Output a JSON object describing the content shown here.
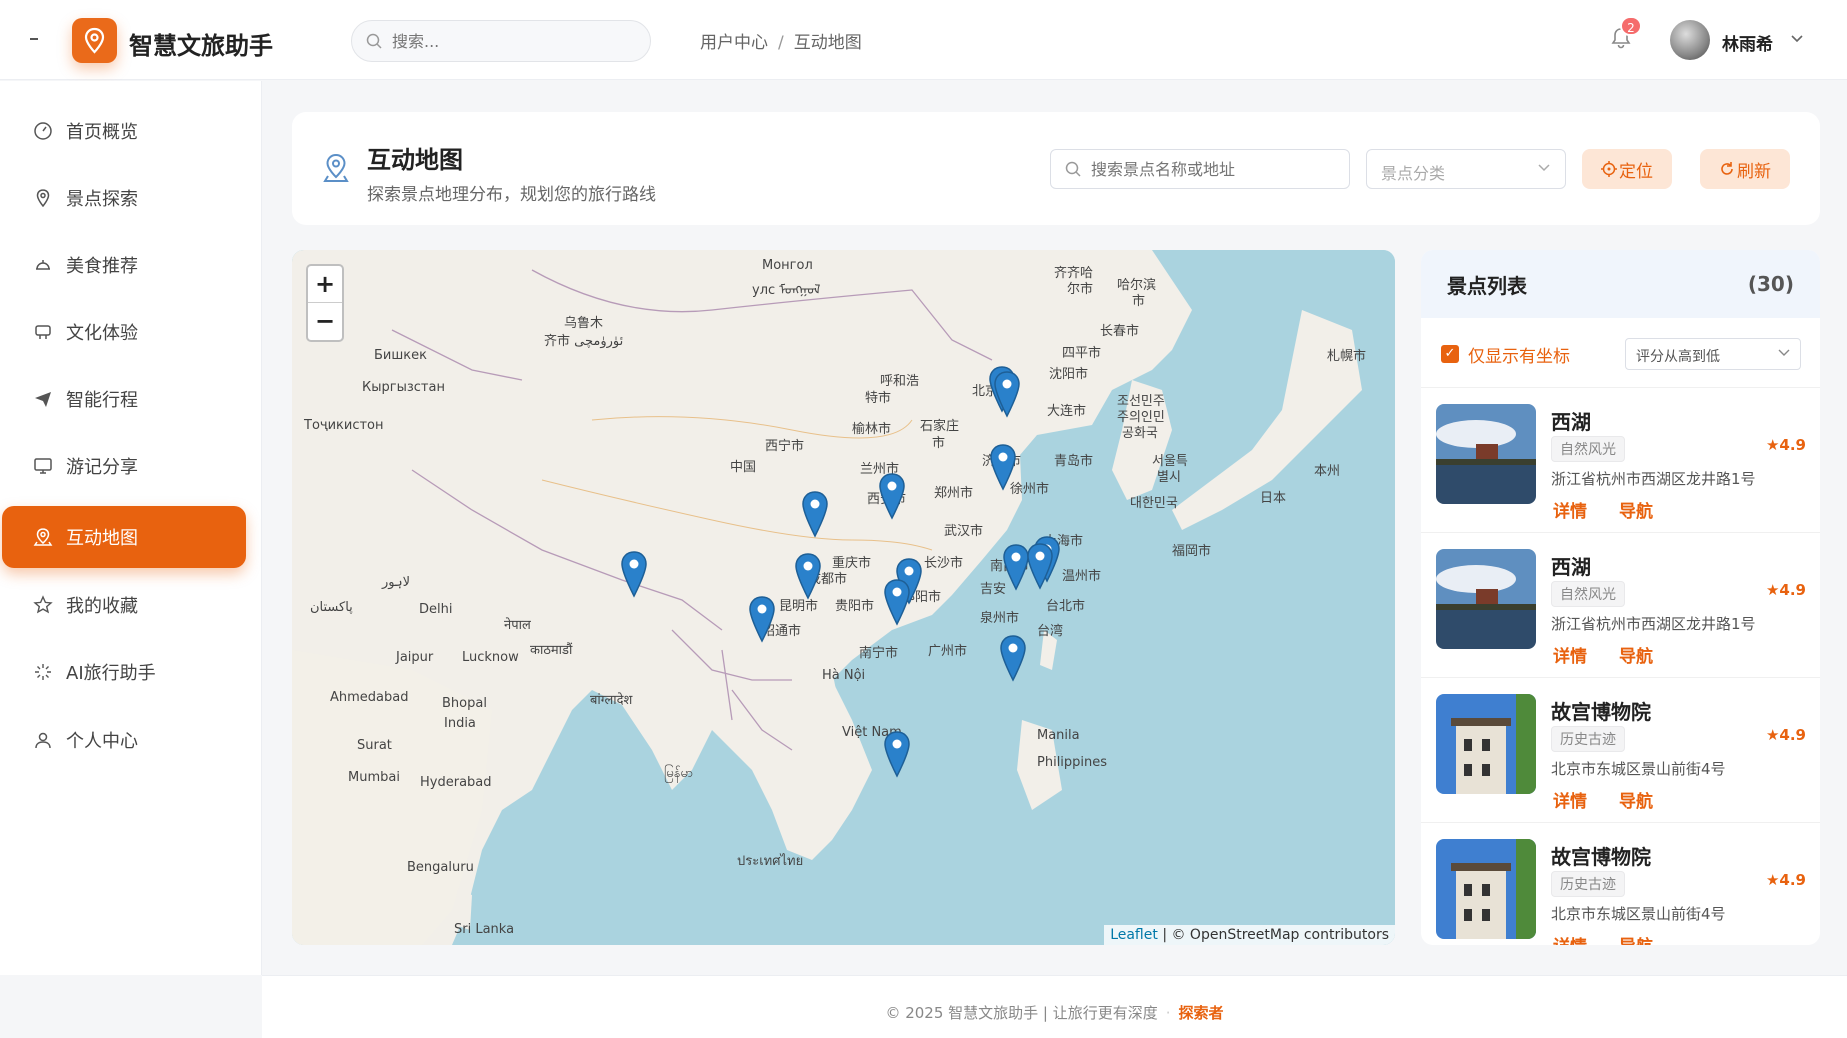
{
  "app": {
    "title": "智慧文旅助手"
  },
  "header": {
    "search_placeholder": "搜索...",
    "breadcrumb": [
      "用户中心",
      "互动地图"
    ],
    "notification_count": "2",
    "username": "林雨希"
  },
  "sidebar": {
    "items": [
      {
        "label": "首页概览",
        "icon": "dashboard-icon"
      },
      {
        "label": "景点探索",
        "icon": "location-pin-icon"
      },
      {
        "label": "美食推荐",
        "icon": "dish-icon"
      },
      {
        "label": "文化体验",
        "icon": "culture-icon"
      },
      {
        "label": "智能行程",
        "icon": "paper-plane-icon"
      },
      {
        "label": "游记分享",
        "icon": "monitor-icon"
      },
      {
        "label": "互动地图",
        "icon": "map-pin-icon",
        "active": true
      },
      {
        "label": "我的收藏",
        "icon": "star-icon"
      },
      {
        "label": "AI旅行助手",
        "icon": "sparkle-icon"
      },
      {
        "label": "个人中心",
        "icon": "user-icon"
      }
    ]
  },
  "page": {
    "title": "互动地图",
    "subtitle": "探索景点地理分布，规划您的旅行路线",
    "search_placeholder": "搜索景点名称或地址",
    "category_placeholder": "景点分类",
    "locate_label": "定位",
    "refresh_label": "刷新"
  },
  "map": {
    "zoom_in": "+",
    "zoom_out": "−",
    "attribution_leaflet": "Leaflet",
    "attribution_text": "| © OpenStreetMap contributors",
    "labels": [
      "Монгол",
      "улс ᠮᠣᠩᠭᠣᠯ",
      "乌鲁木",
      "齐市 ئۈرۈمچی",
      "Бишкек",
      "Кыргызстан",
      "Тоҷикистон",
      "齐齐哈",
      "尔市",
      "哈尔滨",
      "市",
      "长春市",
      "四平市",
      "沈阳市",
      "呼和浩",
      "特市",
      "北京市",
      "大连市",
      "榆林市",
      "石家庄",
      "市",
      "济南市",
      "青岛市",
      "西宁市",
      "中国",
      "兰州市",
      "西安市",
      "郑州市",
      "徐州市",
      "武汉市",
      "上海市",
      "重庆市",
      "长沙市",
      "南昌市",
      "温州市",
      "昆明市",
      "贵阳市",
      "邵阳市",
      "吉安",
      "泉州市",
      "台北市",
      "台湾",
      "南宁市",
      "广州市",
      "Hà Nội",
      "Việt Nam",
      "Manila",
      "Philippines",
      "Delhi",
      "Jaipur",
      "Lucknow",
      "काठमाडौं",
      "नेपाल",
      "Ahmedabad",
      "Bhopal",
      "India",
      "Surat",
      "Mumbai",
      "Hyderabad",
      "Bengaluru",
      "Sri Lanka",
      "बांग्लादेश",
      "မြန်မာ",
      "ประเทศไทย",
      "조선민주",
      "주의인민",
      "공화국",
      "서울특",
      "별시",
      "대한민국",
      "福岡市",
      "日本",
      "本州",
      "札幌市",
      "پاکستان",
      "لاہور",
      "昭通市",
      "成都市"
    ]
  },
  "panel": {
    "title": "景点列表",
    "count": "(30)",
    "filter_label": "仅显示有坐标",
    "sort_label": "评分从高到低",
    "detail_label": "详情",
    "nav_label": "导航",
    "items": [
      {
        "name": "西湖",
        "tag": "自然风光",
        "rating": "4.9",
        "address": "浙江省杭州市西湖区龙井路1号"
      },
      {
        "name": "西湖",
        "tag": "自然风光",
        "rating": "4.9",
        "address": "浙江省杭州市西湖区龙井路1号"
      },
      {
        "name": "故宫博物院",
        "tag": "历史古迹",
        "rating": "4.9",
        "address": "北京市东城区景山前街4号"
      },
      {
        "name": "故宫博物院",
        "tag": "历史古迹",
        "rating": "4.9",
        "address": "北京市东城区景山前街4号"
      }
    ]
  },
  "footer": {
    "copyright": "© 2025 智慧文旅助手 | 让旅行更有深度",
    "accent": "探索者"
  },
  "colors": {
    "accent": "#e8620f",
    "marker": "#2a81cb"
  }
}
